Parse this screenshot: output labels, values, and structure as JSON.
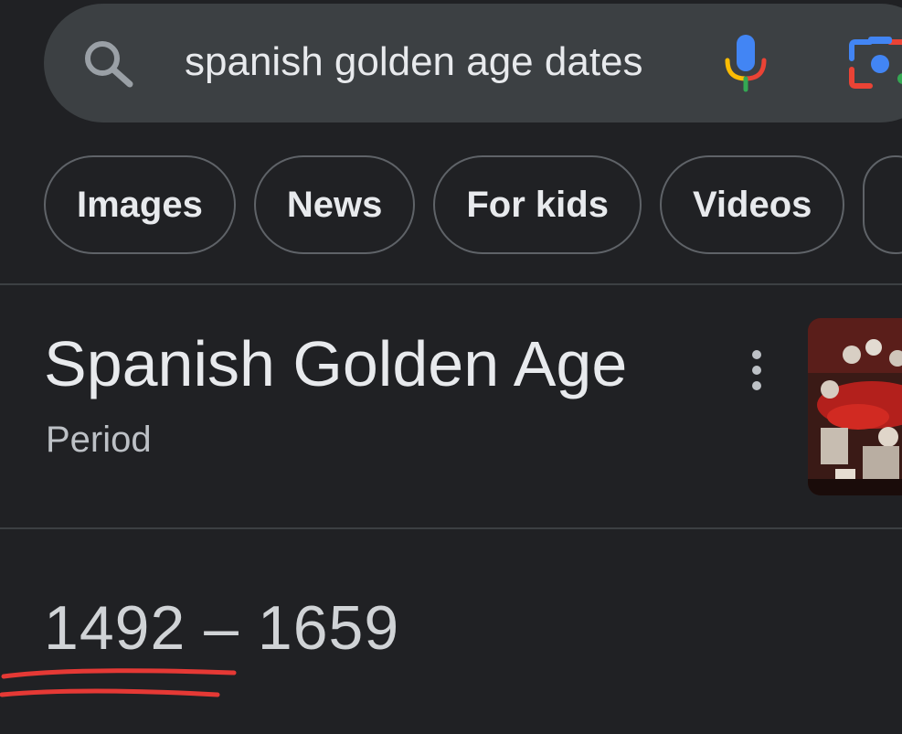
{
  "search": {
    "query": "spanish golden age dates"
  },
  "chips": [
    {
      "label": "Images"
    },
    {
      "label": "News"
    },
    {
      "label": "For kids"
    },
    {
      "label": "Videos"
    }
  ],
  "knowledge_panel": {
    "title": "Spanish Golden Age",
    "subtitle": "Period",
    "dates": "1492 – 1659"
  },
  "colors": {
    "background": "#202124",
    "search_bar": "#3c4043",
    "text_primary": "#e8eaed",
    "text_secondary": "#bdc1c6",
    "annotation_red": "#e53935"
  },
  "icons": {
    "search": "search-icon",
    "mic": "mic-icon",
    "lens": "google-lens-icon",
    "more": "more-vert-icon"
  }
}
